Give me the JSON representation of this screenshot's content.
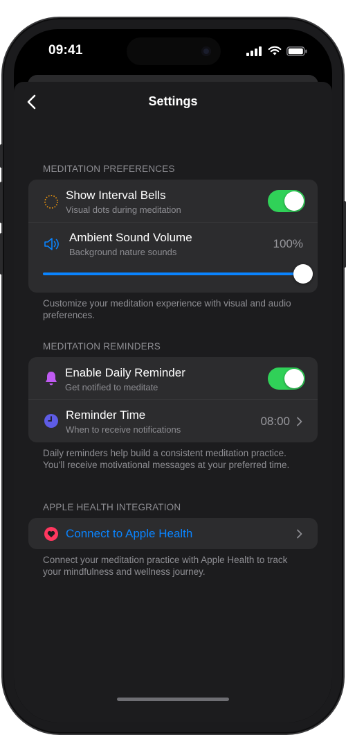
{
  "status_bar": {
    "time": "09:41"
  },
  "nav": {
    "title": "Settings"
  },
  "meditation_preferences": {
    "header": "MEDITATION PREFERENCES",
    "interval_bells": {
      "title": "Show Interval Bells",
      "subtitle": "Visual dots during meditation",
      "enabled": true
    },
    "ambient_sound": {
      "title": "Ambient Sound Volume",
      "subtitle": "Background nature sounds",
      "value": "100%",
      "level": 1.0
    },
    "footer": "Customize your meditation experience with visual and audio preferences."
  },
  "meditation_reminders": {
    "header": "MEDITATION REMINDERS",
    "daily_reminder": {
      "title": "Enable Daily Reminder",
      "subtitle": "Get notified to meditate",
      "enabled": true
    },
    "reminder_time": {
      "title": "Reminder Time",
      "subtitle": "When to receive notifications",
      "value": "08:00"
    },
    "footer": "Daily reminders help build a consistent meditation practice. You'll receive motivational messages at your preferred time."
  },
  "apple_health": {
    "header": "APPLE HEALTH INTEGRATION",
    "connect": {
      "label": "Connect to Apple Health"
    },
    "footer": "Connect your meditation practice with Apple Health to track your mindfulness and wellness journey."
  },
  "colors": {
    "accent": "#0a84ff",
    "toggle_on": "#30d158",
    "bell": "#bf5af2",
    "clock": "#5e5ce6",
    "heart": "#ff375f",
    "interval_dots": "#ff9f0a"
  },
  "icons": {
    "back": "chevron-left-icon",
    "interval": "dotted-circle-icon",
    "sound": "speaker-wave-icon",
    "bell": "bell-icon",
    "clock": "clock-icon",
    "heart": "heart-icon"
  }
}
